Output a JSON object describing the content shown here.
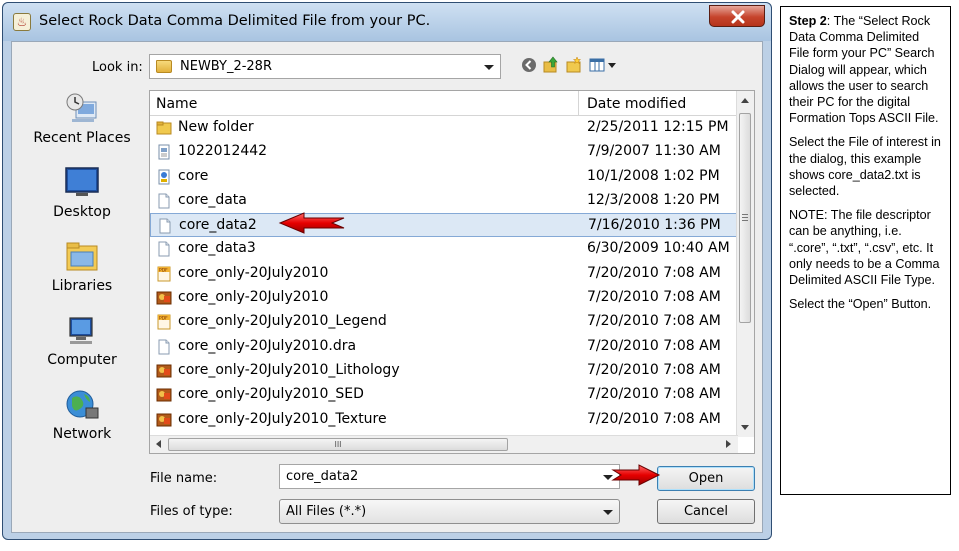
{
  "window": {
    "title": "Select Rock Data Comma Delimited File from your PC."
  },
  "look_in": {
    "label": "Look in:",
    "value": "NEWBY_2-28R"
  },
  "toolbar": {
    "icons": [
      "back-icon",
      "up-folder-icon",
      "new-folder-icon",
      "view-menu-icon"
    ]
  },
  "places": [
    {
      "label": "Recent Places",
      "icon": "recent-places-icon"
    },
    {
      "label": "Desktop",
      "icon": "desktop-icon"
    },
    {
      "label": "Libraries",
      "icon": "libraries-icon"
    },
    {
      "label": "Computer",
      "icon": "computer-icon"
    },
    {
      "label": "Network",
      "icon": "network-icon"
    }
  ],
  "file_list": {
    "columns": [
      "Name",
      "Date modified"
    ],
    "selected_index": 4,
    "files": [
      {
        "name": "New folder",
        "date": "2/25/2011 12:15 PM",
        "icon": "folder-icon"
      },
      {
        "name": "1022012442",
        "date": "7/9/2007 11:30 AM",
        "icon": "text-file-icon"
      },
      {
        "name": "core",
        "date": "10/1/2008 1:02 PM",
        "icon": "app-file-icon"
      },
      {
        "name": "core_data",
        "date": "12/3/2008 1:20 PM",
        "icon": "file-icon"
      },
      {
        "name": "core_data2",
        "date": "7/16/2010 1:36 PM",
        "icon": "file-icon"
      },
      {
        "name": "core_data3",
        "date": "6/30/2009 10:40 AM",
        "icon": "file-icon"
      },
      {
        "name": "core_only-20July2010",
        "date": "7/20/2010 7:08 AM",
        "icon": "pdf-file-icon"
      },
      {
        "name": "core_only-20July2010",
        "date": "7/20/2010 7:08 AM",
        "icon": "image-file-icon"
      },
      {
        "name": "core_only-20July2010_Legend",
        "date": "7/20/2010 7:08 AM",
        "icon": "pdf-file-icon"
      },
      {
        "name": "core_only-20July2010.dra",
        "date": "7/20/2010 7:08 AM",
        "icon": "file-icon"
      },
      {
        "name": "core_only-20July2010_Lithology",
        "date": "7/20/2010 7:08 AM",
        "icon": "image-file-icon"
      },
      {
        "name": "core_only-20July2010_SED",
        "date": "7/20/2010 7:08 AM",
        "icon": "image-file-icon"
      },
      {
        "name": "core_only-20July2010_Texture",
        "date": "7/20/2010 7:08 AM",
        "icon": "image-file-icon"
      }
    ],
    "hscroll_grip": "III"
  },
  "file_name": {
    "label": "File name:",
    "value": "core_data2"
  },
  "file_type": {
    "label": "Files of type:",
    "value": "All Files (*.*)"
  },
  "buttons": {
    "open": "Open",
    "cancel": "Cancel"
  },
  "note": {
    "step_bold": "Step 2",
    "step_text": ": The “Select Rock Data Comma Delimited File form your PC” Search Dialog will appear, which allows the user to search their PC for the digital Formation Tops ASCII File.",
    "p2": "Select the File of interest in  the dialog, this example shows core_data2.txt is selected.",
    "p3": "NOTE: The file descriptor can be anything, i.e. “.core”, “.txt”, “.csv”, etc. It only needs to be a Comma Delimited ASCII File Type.",
    "p4": "Select the “Open” Button."
  },
  "colors": {
    "selection": "#dce8f5",
    "annotation_arrow": "#e60000",
    "title_bar": "#bcd0e6",
    "close_button": "#c6442c"
  }
}
